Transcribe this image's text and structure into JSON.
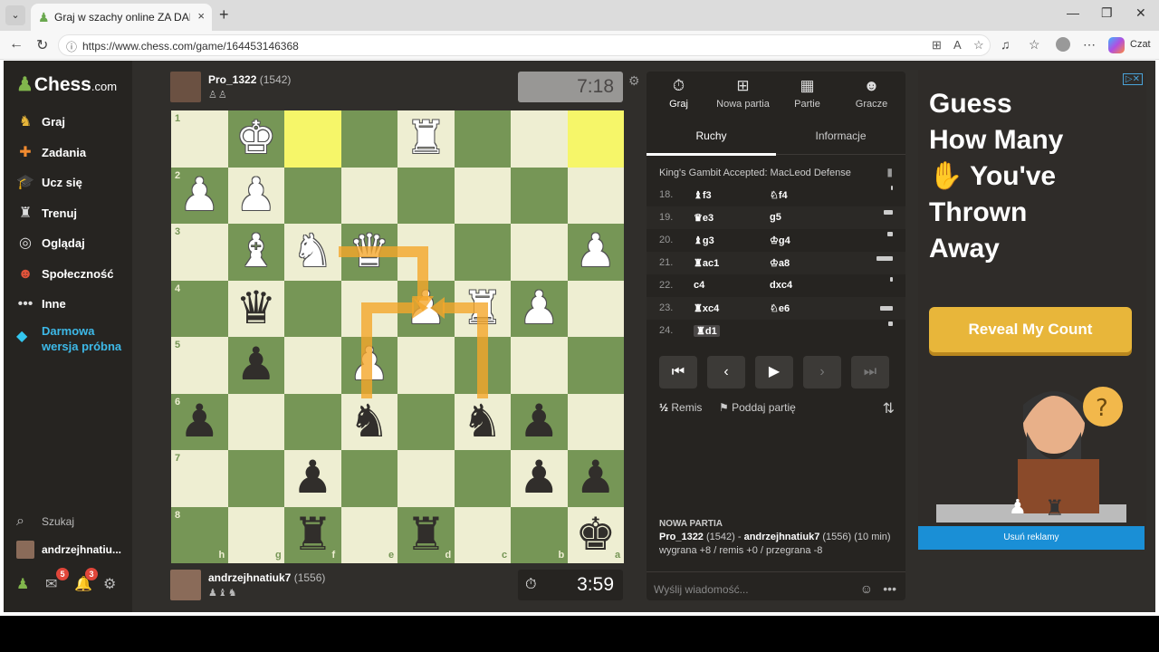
{
  "browser": {
    "tab_title": "Graj w szachy online ZA DARMO",
    "tab_close": "×",
    "new_tab": "+",
    "url": "https://www.chess.com/game/164453146368",
    "czat_label": "Czat"
  },
  "site": {
    "logo_text": "Chess",
    "logo_suffix": ".com",
    "nav": [
      {
        "label": "Graj",
        "icon": "play-icon"
      },
      {
        "label": "Zadania",
        "icon": "puzzle-icon"
      },
      {
        "label": "Ucz się",
        "icon": "learn-icon"
      },
      {
        "label": "Trenuj",
        "icon": "train-icon"
      },
      {
        "label": "Oglądaj",
        "icon": "watch-icon"
      },
      {
        "label": "Społeczność",
        "icon": "community-icon"
      },
      {
        "label": "Inne",
        "icon": "more-icon"
      }
    ],
    "trial_label": "Darmowa wersja próbna",
    "search_label": "Szukaj",
    "username": "andrzejhnatiu...",
    "messages_badge": "5",
    "notifications_badge": "3"
  },
  "game": {
    "top_player": {
      "name": "Pro_1322",
      "rating": "(1542)",
      "clock": "7:18"
    },
    "bottom_player": {
      "name": "andrzejhnatiuk7",
      "rating": "(1556)",
      "clock": "3:59"
    },
    "ranks": [
      "1",
      "2",
      "3",
      "4",
      "5",
      "6",
      "7",
      "8"
    ],
    "files": [
      "h",
      "g",
      "f",
      "e",
      "d",
      "c",
      "b",
      "a"
    ]
  },
  "panel": {
    "tabs": [
      "Graj",
      "Nowa partia",
      "Partie",
      "Gracze"
    ],
    "subtabs": [
      "Ruchy",
      "Informacje"
    ],
    "opening": "King's Gambit Accepted: MacLeod Defense",
    "moves": [
      {
        "num": "18.",
        "white": "♝f3",
        "black": "♘f4"
      },
      {
        "num": "19.",
        "white": "♛e3",
        "black": "g5"
      },
      {
        "num": "20.",
        "white": "♝g3",
        "black": "♔g4"
      },
      {
        "num": "21.",
        "white": "♜ac1",
        "black": "♔a8"
      },
      {
        "num": "22.",
        "white": "c4",
        "black": "dxc4"
      },
      {
        "num": "23.",
        "white": "♜xc4",
        "black": "♘e6"
      },
      {
        "num": "24.",
        "white": "♜d1",
        "black": ""
      }
    ],
    "draw_label": "Remis",
    "resign_label": "Poddaj partię",
    "info_heading": "NOWA PARTIA",
    "info_p1": "Pro_1322",
    "info_p1_rating": "(1542)",
    "info_p2": "andrzejhnatiuk7",
    "info_p2_rating": "(1556)",
    "info_time": "(10 min)",
    "info_stakes": "wygrana +8 / remis +0 / przegrana -8",
    "chat_placeholder": "Wyślij wiadomość..."
  },
  "ad": {
    "headline_1": "Guess",
    "headline_2": "How Many",
    "headline_3": "You've",
    "headline_4": "Thrown",
    "headline_5": "Away",
    "cta": "Reveal My Count",
    "remove": "Usuń reklamy"
  }
}
